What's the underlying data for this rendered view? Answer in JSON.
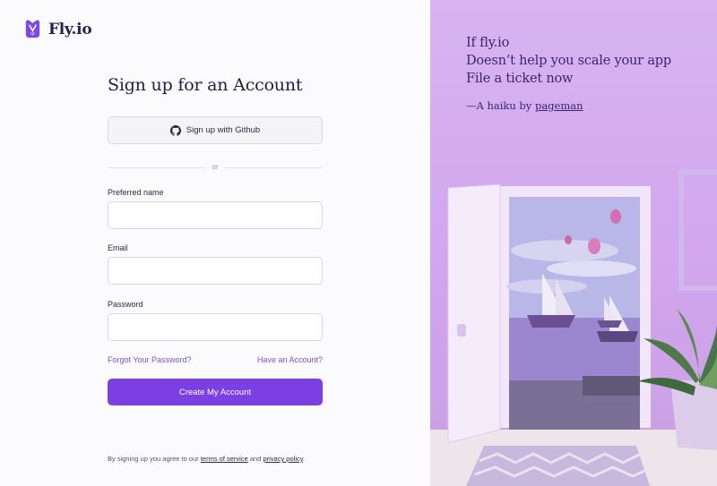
{
  "brand": {
    "name": "Fly.io"
  },
  "form": {
    "title": "Sign up for an Account",
    "github_button": "Sign up with Github",
    "divider": "or",
    "fields": [
      {
        "label": "Preferred name",
        "value": "",
        "placeholder": ""
      },
      {
        "label": "Email",
        "value": "",
        "placeholder": ""
      },
      {
        "label": "Password",
        "value": "",
        "placeholder": ""
      }
    ],
    "forgot_link": "Forgot Your Password?",
    "login_link": "Have an Account?",
    "submit": "Create My Account",
    "terms": {
      "prefix": "By signing up you agree to our",
      "tos": "terms of service",
      "and": "and",
      "privacy": "privacy policy",
      "suffix": "."
    }
  },
  "haiku": {
    "lines": [
      "If fly.io",
      "Doesn’t help you scale your app",
      "File a ticket now"
    ],
    "attribution_prefix": "—A haiku by",
    "author": "pageman"
  },
  "colors": {
    "accent": "#7b3fe4",
    "link": "#7b4fe0",
    "panel_bg": "#d3a9ef",
    "heading": "#241b4a"
  }
}
